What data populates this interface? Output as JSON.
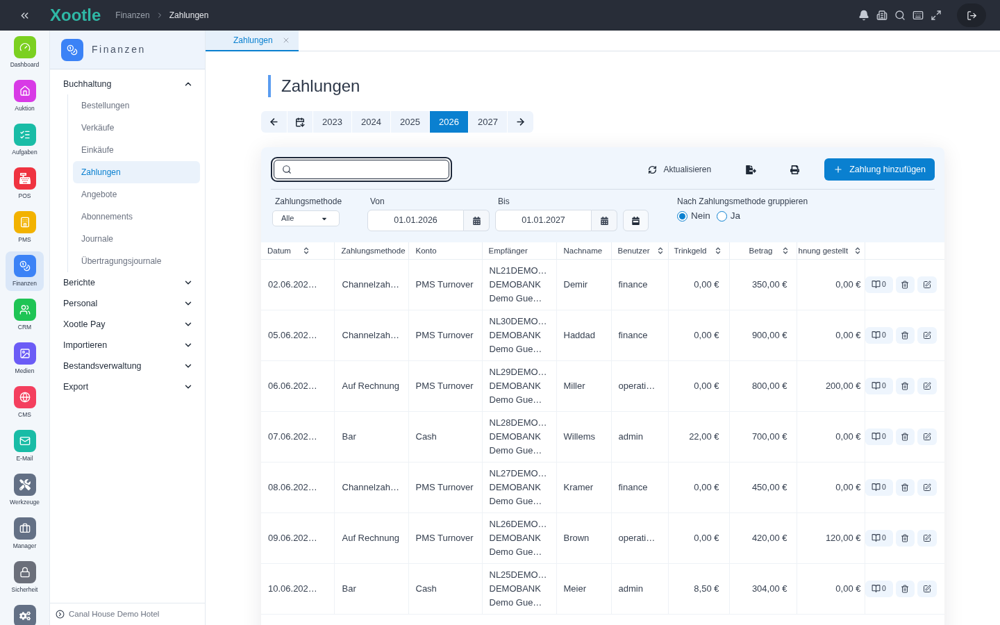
{
  "topbar": {
    "logo": "Xootle",
    "breadcrumb": [
      "Finanzen",
      "Zahlungen"
    ]
  },
  "apps": [
    {
      "label": "Dashboard",
      "color": "#7bd020",
      "selected": false
    },
    {
      "label": "Auktion",
      "color": "#d83ae6",
      "selected": false
    },
    {
      "label": "Aufgaben",
      "color": "#19bca6",
      "selected": false
    },
    {
      "label": "POS",
      "color": "#ef3340",
      "selected": false
    },
    {
      "label": "PMS",
      "color": "#f2b200",
      "selected": false
    },
    {
      "label": "Finanzen",
      "color": "#3b82f6",
      "selected": true
    },
    {
      "label": "CRM",
      "color": "#1fc455",
      "selected": false
    },
    {
      "label": "Medien",
      "color": "#6b5cf6",
      "selected": false
    },
    {
      "label": "CMS",
      "color": "#f43f5e",
      "selected": false
    },
    {
      "label": "E-Mail",
      "color": "#19bca6",
      "selected": false
    },
    {
      "label": "Werkzeuge",
      "color": "#637085",
      "selected": false
    },
    {
      "label": "Manager",
      "color": "#637085",
      "selected": false
    },
    {
      "label": "Sicherheit",
      "color": "#6b6f7a",
      "selected": false
    },
    {
      "color": "#637085",
      "selected": false
    }
  ],
  "module": {
    "title": "Finanzen"
  },
  "menu": [
    {
      "label": "Buchhaltung",
      "expanded": true,
      "children": [
        {
          "label": "Bestellungen",
          "selected": false
        },
        {
          "label": "Verkäufe",
          "selected": false
        },
        {
          "label": "Einkäufe",
          "selected": false
        },
        {
          "label": "Zahlungen",
          "selected": true
        },
        {
          "label": "Angebote",
          "selected": false
        },
        {
          "label": "Abonnements",
          "selected": false
        },
        {
          "label": "Journale",
          "selected": false
        },
        {
          "label": "Übertragungsjournale",
          "selected": false
        }
      ]
    },
    {
      "label": "Berichte",
      "expanded": false
    },
    {
      "label": "Personal",
      "expanded": false
    },
    {
      "label": "Xootle Pay",
      "expanded": false
    },
    {
      "label": "Importieren",
      "expanded": false
    },
    {
      "label": "Bestandsverwaltung",
      "expanded": false
    },
    {
      "label": "Export",
      "expanded": false
    }
  ],
  "footer": {
    "hotel": "Canal House Demo Hotel"
  },
  "tabs": [
    {
      "label": "Zahlungen",
      "selected": true
    }
  ],
  "page_title": "Zahlungen",
  "years": [
    {
      "label": "2023",
      "selected": false
    },
    {
      "label": "2024",
      "selected": false
    },
    {
      "label": "2025",
      "selected": false
    },
    {
      "label": "2026",
      "selected": true
    },
    {
      "label": "2027",
      "selected": false
    }
  ],
  "toolbar": {
    "search": {
      "focused": true
    },
    "refresh": "Aktualisieren",
    "add": "Zahlung hinzufügen"
  },
  "filters": {
    "method": {
      "label": "Zahlungsmethode",
      "value": "Alle"
    },
    "from": {
      "label": "Von",
      "value": "01.01.2026"
    },
    "to": {
      "label": "Bis",
      "value": "01.01.2027"
    },
    "group": {
      "label": "Nach Zahlungsmethode gruppieren",
      "options": [
        {
          "label": "Nein",
          "selected": true
        },
        {
          "label": "Ja",
          "selected": false
        }
      ]
    }
  },
  "table": {
    "columns": [
      {
        "label": "Datum",
        "sortable": true
      },
      {
        "label": "Zahlungsmethode",
        "sortable": false
      },
      {
        "label": "Konto",
        "sortable": false
      },
      {
        "label": "Empfänger",
        "sortable": false
      },
      {
        "label": "Nachname",
        "sortable": false
      },
      {
        "label": "Benutzer",
        "sortable": true
      },
      {
        "label": "Trinkgeld",
        "sortable": true
      },
      {
        "label": "Betrag",
        "sortable": true
      },
      {
        "label": "hnung gestellt",
        "sortable": true
      }
    ],
    "rows": [
      {
        "cells": [
          "02.06.202…",
          "Channelzah…",
          "PMS Turnover",
          [
            "NL21DEMO…",
            "DEMOBANK",
            "Demo Gue…"
          ],
          "Demir",
          "finance",
          "0,00 €",
          "350,00 €",
          "0,00 €"
        ],
        "notes": "0"
      },
      {
        "cells": [
          "05.06.202…",
          "Channelzah…",
          "PMS Turnover",
          [
            "NL30DEMO…",
            "DEMOBANK",
            "Demo Gue…"
          ],
          "Haddad",
          "finance",
          "0,00 €",
          "900,00 €",
          "0,00 €"
        ],
        "notes": "0"
      },
      {
        "cells": [
          "06.06.202…",
          "Auf Rechnung",
          "PMS Turnover",
          [
            "NL29DEMO…",
            "DEMOBANK",
            "Demo Gue…"
          ],
          "Miller",
          "operati…",
          "0,00 €",
          "800,00 €",
          "200,00 €"
        ],
        "notes": "0"
      },
      {
        "cells": [
          "07.06.202…",
          "Bar",
          "Cash",
          [
            "NL28DEMO…",
            "DEMOBANK",
            "Demo Gue…"
          ],
          "Willems",
          "admin",
          "22,00 €",
          "700,00 €",
          "0,00 €"
        ],
        "notes": "0"
      },
      {
        "cells": [
          "08.06.202…",
          "Channelzah…",
          "PMS Turnover",
          [
            "NL27DEMO…",
            "DEMOBANK",
            "Demo Gue…"
          ],
          "Kramer",
          "finance",
          "0,00 €",
          "450,00 €",
          "0,00 €"
        ],
        "notes": "0"
      },
      {
        "cells": [
          "09.06.202…",
          "Auf Rechnung",
          "PMS Turnover",
          [
            "NL26DEMO…",
            "DEMOBANK",
            "Demo Gue…"
          ],
          "Brown",
          "operati…",
          "0,00 €",
          "420,00 €",
          "120,00 €"
        ],
        "notes": "0"
      },
      {
        "cells": [
          "10.06.202…",
          "Bar",
          "Cash",
          [
            "NL25DEMO…",
            "DEMOBANK",
            "Demo Gue…"
          ],
          "Meier",
          "admin",
          "8,50 €",
          "304,00 €",
          "0,00 €"
        ],
        "notes": "0"
      }
    ]
  }
}
